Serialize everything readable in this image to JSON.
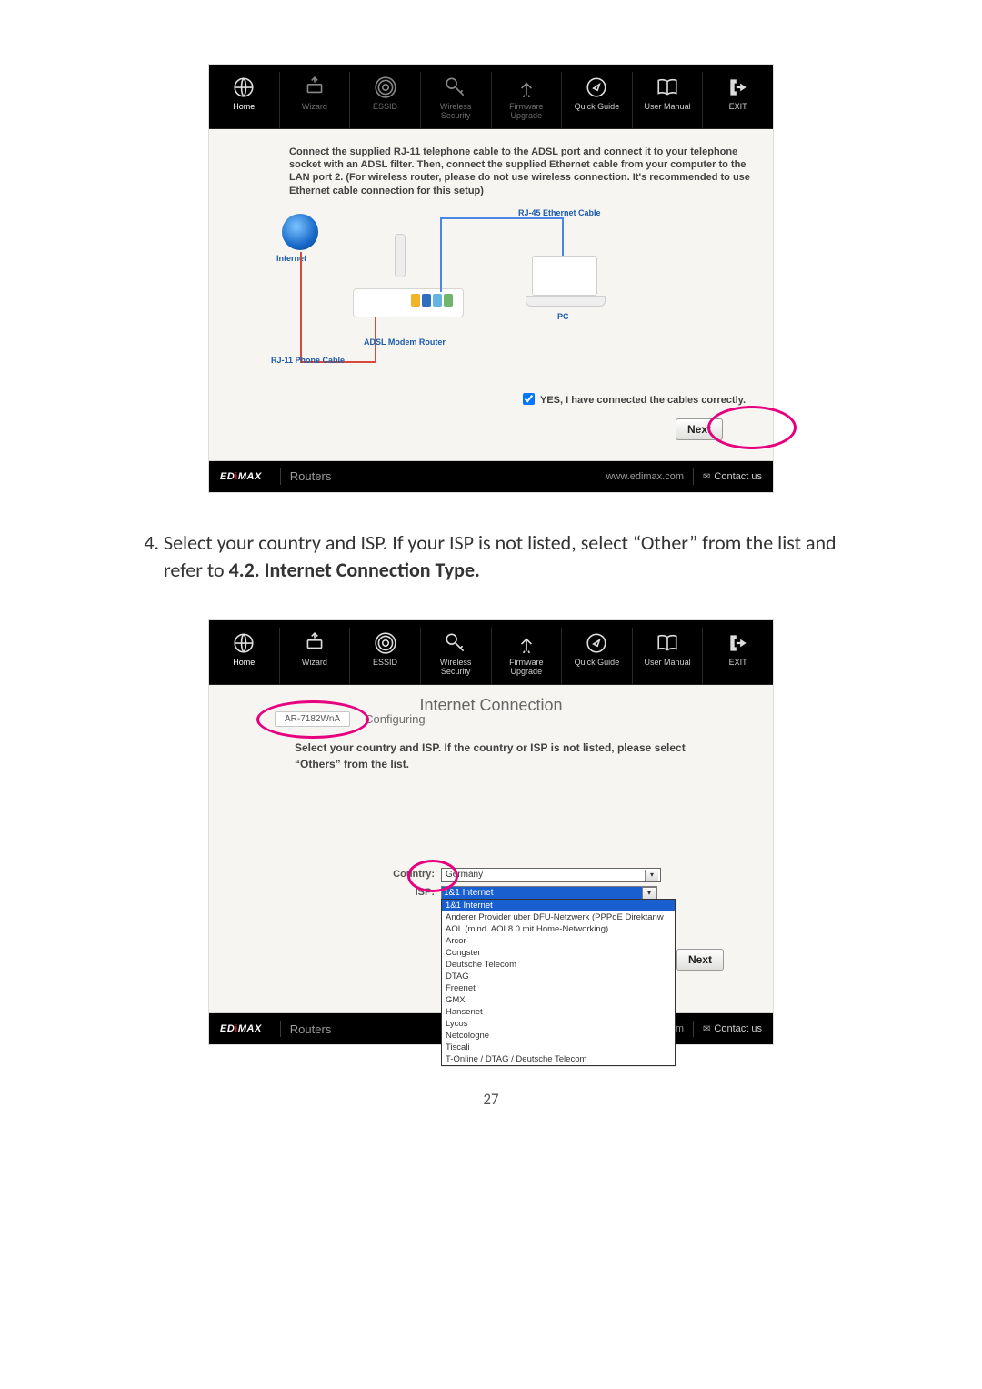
{
  "nav": {
    "items": [
      {
        "label": "Home"
      },
      {
        "label": "Wizard"
      },
      {
        "label": "ESSID"
      },
      {
        "label_l1": "Wireless",
        "label_l2": "Security"
      },
      {
        "label_l1": "Firmware",
        "label_l2": "Upgrade"
      },
      {
        "label": "Quick Guide"
      },
      {
        "label": "User Manual"
      },
      {
        "label": "EXIT"
      }
    ]
  },
  "footer": {
    "routers": "Routers",
    "url": "www.edimax.com",
    "contact": "Contact us"
  },
  "s1": {
    "instruction": "Connect the supplied RJ-11 telephone cable to the ADSL port and connect it to your telephone socket with an ADSL filter. Then, connect the supplied Ethernet cable from your computer to the LAN port 2. (For wireless router, please do not use wireless connection. It's recommended to use Ethernet cable connection for this setup)",
    "labels": {
      "internet": "Internet",
      "rj45": "RJ-45 Ethernet Cable",
      "rj11": "RJ-11 Phone Cable",
      "router": "ADSL Modem Router",
      "pc": "PC"
    },
    "checkbox_label": "YES, I have connected the cables correctly.",
    "next": "Next"
  },
  "step4_text_a": "Select your country and ISP. If your ISP is not listed, select “Other” from the list and refer to ",
  "step4_text_b": "4.2. Internet Connection Type.",
  "s2": {
    "title": "Internet Connection",
    "model": "AR-7182WnA",
    "configuring": "Configuring",
    "hint": "Select your country and ISP. If the country or ISP is not listed, please select “Others” from the list.",
    "labels": {
      "country": "Country:",
      "isp": "ISP:"
    },
    "values": {
      "country": "Germany",
      "isp_selected": "1&1 Internet"
    },
    "isp_options": [
      "1&1 Internet",
      "Anderer Provider uber DFU-Netzwerk (PPPoE Direktanw",
      "AOL (mind. AOL8.0 mit Home-Networking)",
      "Arcor",
      "Congster",
      "Deutsche Telecom",
      "DTAG",
      "Freenet",
      "GMX",
      "Hansenet",
      "Lycos",
      "Netcologne",
      "Tiscali",
      "T-Online / DTAG / Deutsche Telecom"
    ],
    "next": "Next",
    "url_cut": "om"
  },
  "page_number": "27"
}
